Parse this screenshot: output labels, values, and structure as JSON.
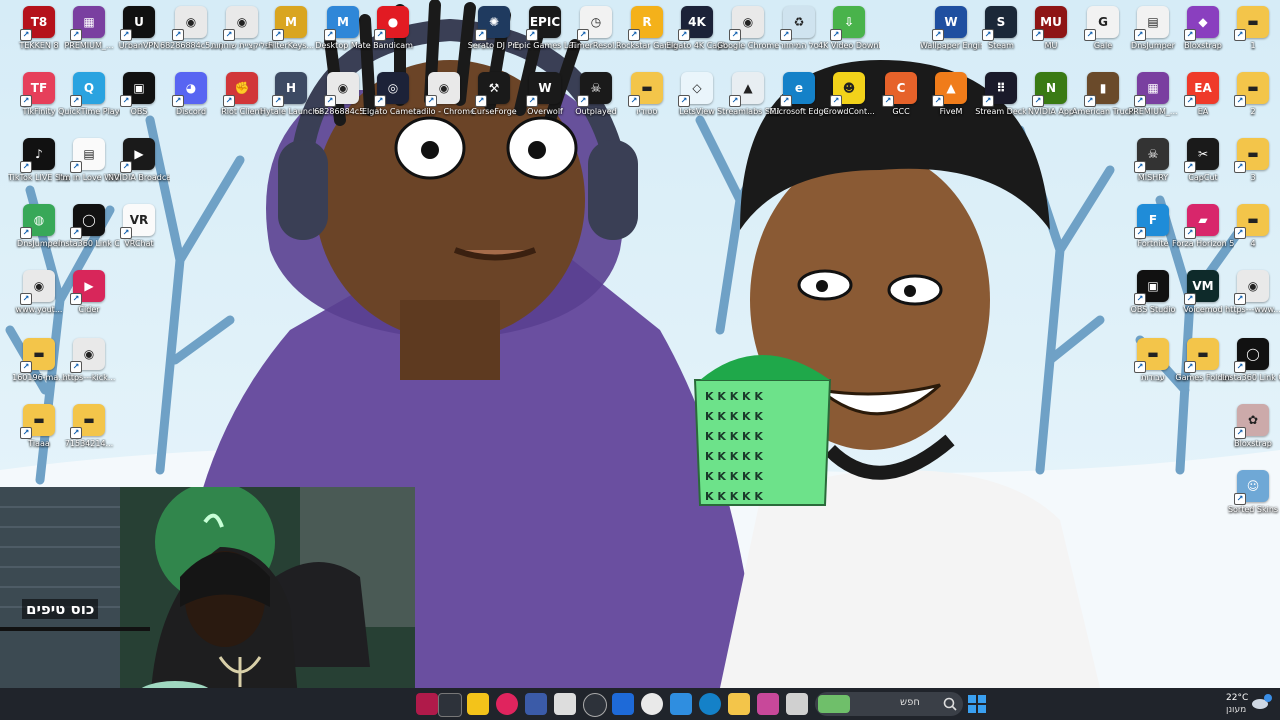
{
  "desktop": {
    "icons": [
      {
        "label": "TEKKEN 8",
        "name": "tekken8",
        "color": "#b5121b",
        "glyph": "T8"
      },
      {
        "label": "PREMIUM_...",
        "name": "premium-1",
        "color": "#7a3fa0",
        "glyph": "▦"
      },
      {
        "label": "UrbanVPN",
        "name": "urbanvpn",
        "color": "#101010",
        "glyph": "U"
      },
      {
        "label": "68286884c5... עותק",
        "name": "chrome-file-1",
        "color": "#e9e9e9",
        "glyph": "◉"
      },
      {
        "label": "אפליקציית שוחחות",
        "name": "chrome-app-1",
        "color": "#e9e9e9",
        "glyph": "◉"
      },
      {
        "label": "FilterKeys...",
        "name": "filterkeys",
        "color": "#d9a520",
        "glyph": "M"
      },
      {
        "label": "Desktop Mate",
        "name": "desktop-mate",
        "color": "#2f87d8",
        "glyph": "M"
      },
      {
        "label": "Bandicam",
        "name": "bandicam",
        "color": "#e21b23",
        "glyph": "●"
      },
      {
        "label": "Serato DJ Pro",
        "name": "serato",
        "color": "#1f3a5f",
        "glyph": "✺"
      },
      {
        "label": "Epic Games Launcher",
        "name": "epic-games",
        "color": "#1a1a1a",
        "glyph": "EPIC"
      },
      {
        "label": "TimerResol...",
        "name": "timerres",
        "color": "#f2f2f2",
        "glyph": "◷"
      },
      {
        "label": "Rockstar Games...",
        "name": "rockstar",
        "color": "#f4b11a",
        "glyph": "R"
      },
      {
        "label": "Elgato 4K Captur...",
        "name": "elgato-4k",
        "color": "#1c2238",
        "glyph": "4K"
      },
      {
        "label": "Google Chrome",
        "name": "google-chrome",
        "color": "#e9e9e9",
        "glyph": "◉"
      },
      {
        "label": "סל המיחזור",
        "name": "recycle-bin",
        "color": "#cfe3ef",
        "glyph": "♻"
      },
      {
        "label": "4K Video Downloader+",
        "name": "4k-video",
        "color": "#49b34b",
        "glyph": "⇩"
      },
      {
        "label": "Wallpaper Engine",
        "name": "wallpaper-engine",
        "color": "#1f4fa0",
        "glyph": "W"
      },
      {
        "label": "Steam",
        "name": "steam",
        "color": "#1b2838",
        "glyph": "S"
      },
      {
        "label": "MU",
        "name": "mu",
        "color": "#8e1515",
        "glyph": "MU"
      },
      {
        "label": "Gale",
        "name": "gale",
        "color": "#f2f2f2",
        "glyph": "G"
      },
      {
        "label": "DnsJumper",
        "name": "dnsjumper-file",
        "color": "#f2f2f2",
        "glyph": "▤"
      },
      {
        "label": "Bloxstrap",
        "name": "bloxstrap",
        "color": "#8a3fbf",
        "glyph": "◆"
      },
      {
        "label": "1",
        "name": "folder-1",
        "color": "#f3c54a",
        "glyph": "▬"
      },
      {
        "label": "TikFinity",
        "name": "tikfinity",
        "color": "#e63f5a",
        "glyph": "TF"
      },
      {
        "label": "QuickTime Player",
        "name": "quicktime",
        "color": "#2aa3e0",
        "glyph": "Q"
      },
      {
        "label": "OBS",
        "name": "obs-file",
        "color": "#111",
        "glyph": "▣"
      },
      {
        "label": "Discord",
        "name": "discord",
        "color": "#5865f2",
        "glyph": "◕"
      },
      {
        "label": "Riot Client",
        "name": "riot",
        "color": "#d13639",
        "glyph": "✊"
      },
      {
        "label": "Hytale Launcher",
        "name": "hytale",
        "color": "#3d4a63",
        "glyph": "H"
      },
      {
        "label": "68286884c5...",
        "name": "chrome-file-2",
        "color": "#e9e9e9",
        "glyph": "◉"
      },
      {
        "label": "Elgato Camera Hub",
        "name": "elgato-cam",
        "color": "#1c2238",
        "glyph": "◎"
      },
      {
        "label": "tadilo - Chrome",
        "name": "tadilo",
        "color": "#e9e9e9",
        "glyph": "◉"
      },
      {
        "label": "CurseForge",
        "name": "curseforge",
        "color": "#1a1a1a",
        "glyph": "⚒"
      },
      {
        "label": "Overwolf",
        "name": "overwolf",
        "color": "#1a1a1a",
        "glyph": "W"
      },
      {
        "label": "Outplayed",
        "name": "outplayed",
        "color": "#1a1a1a",
        "glyph": "☠"
      },
      {
        "label": "סטודיו",
        "name": "folder-studio",
        "color": "#f3c54a",
        "glyph": "▬"
      },
      {
        "label": "LetsView",
        "name": "letsview",
        "color": "#eaf5fb",
        "glyph": "◇"
      },
      {
        "label": "Streamlabs SE.Live",
        "name": "streamlabs",
        "color": "#e8eef2",
        "glyph": "▲"
      },
      {
        "label": "Microsoft Edge",
        "name": "edge",
        "color": "#1481c8",
        "glyph": "e"
      },
      {
        "label": "CrowdCont...",
        "name": "crowdcontrol",
        "color": "#f2d21a",
        "glyph": "☻"
      },
      {
        "label": "GCC",
        "name": "gcc",
        "color": "#e6622a",
        "glyph": "C"
      },
      {
        "label": "FiveM",
        "name": "fivem",
        "color": "#f07c1a",
        "glyph": "▲"
      },
      {
        "label": "Stream Deck",
        "name": "stream-deck",
        "color": "#1a1a2a",
        "glyph": "⠿"
      },
      {
        "label": "NVIDIA App",
        "name": "nvidia-app",
        "color": "#3a7a14",
        "glyph": "N"
      },
      {
        "label": "American Truck Si...",
        "name": "ats",
        "color": "#6a4a2a",
        "glyph": "▮"
      },
      {
        "label": "PREMIUM_...",
        "name": "premium-2",
        "color": "#7a3fa0",
        "glyph": "▦"
      },
      {
        "label": "EA",
        "name": "ea",
        "color": "#ef3a2a",
        "glyph": "EA"
      },
      {
        "label": "2",
        "name": "folder-2",
        "color": "#f3c54a",
        "glyph": "▬"
      },
      {
        "label": "TikTok LIVE Studio",
        "name": "tiktok-live",
        "color": "#111",
        "glyph": "♪"
      },
      {
        "label": "I'm in Love With Your ...",
        "name": "txt-file",
        "color": "#fafafa",
        "glyph": "▤"
      },
      {
        "label": "NVIDIA Broadcast",
        "name": "nvidia-broadcast",
        "color": "#1a1a1a",
        "glyph": "▶"
      },
      {
        "label": "MISHRY",
        "name": "mishry",
        "color": "#333",
        "glyph": "☠"
      },
      {
        "label": "CapCut",
        "name": "capcut",
        "color": "#1a1a1a",
        "glyph": "✂"
      },
      {
        "label": "3",
        "name": "folder-3",
        "color": "#f3c54a",
        "glyph": "▬"
      },
      {
        "label": "DnsJumper",
        "name": "dnsjumper",
        "color": "#38a858",
        "glyph": "◍"
      },
      {
        "label": "Insta360 Link Controller",
        "name": "insta360",
        "color": "#111",
        "glyph": "◯"
      },
      {
        "label": "VRChat",
        "name": "vrchat",
        "color": "#fafafa",
        "glyph": "VR"
      },
      {
        "label": "Fortnite",
        "name": "fortnite",
        "color": "#1f8cd8",
        "glyph": "F"
      },
      {
        "label": "Forza Horizon 5",
        "name": "forza",
        "color": "#d8266b",
        "glyph": "▰"
      },
      {
        "label": "4",
        "name": "folder-4",
        "color": "#f3c54a",
        "glyph": "▬"
      },
      {
        "label": "www.yout...",
        "name": "youtube-link",
        "color": "#e9e9e9",
        "glyph": "◉"
      },
      {
        "label": "Cider",
        "name": "cider",
        "color": "#d8265a",
        "glyph": "▶"
      },
      {
        "label": "OBS Studio",
        "name": "obs-studio",
        "color": "#111",
        "glyph": "▣"
      },
      {
        "label": "Voicemod",
        "name": "voicemod",
        "color": "#0e2a2a",
        "glyph": "VM"
      },
      {
        "label": "https---www...",
        "name": "chrome-link",
        "color": "#e9e9e9",
        "glyph": "◉"
      },
      {
        "label": "160196-ma...",
        "name": "folder-160196",
        "color": "#f3c54a",
        "glyph": "▬"
      },
      {
        "label": "https---kick...",
        "name": "kick-link",
        "color": "#e9e9e9",
        "glyph": "◉"
      },
      {
        "label": "עבודות",
        "name": "folder-work",
        "color": "#f3c54a",
        "glyph": "▬"
      },
      {
        "label": "Games Folder",
        "name": "folder-games",
        "color": "#f3c54a",
        "glyph": "▬"
      },
      {
        "label": "Insta360 Link Controller",
        "name": "insta360-2",
        "color": "#111",
        "glyph": "◯"
      },
      {
        "label": "Tiaaa",
        "name": "folder-tiaaa",
        "color": "#f3c54a",
        "glyph": "▬"
      },
      {
        "label": "71534214...",
        "name": "folder-7153",
        "color": "#f3c54a",
        "glyph": "▬"
      },
      {
        "label": "Bloxstrap",
        "name": "bloxstrap-img",
        "color": "#caa",
        "glyph": "✿"
      },
      {
        "label": "Sorted Skins",
        "name": "sorted-skins",
        "color": "#6fa8d6",
        "glyph": "☺"
      }
    ]
  },
  "webcam": {
    "caption": "כוס טיפים"
  },
  "taskbar": {
    "search_placeholder": "חפש",
    "weather_temp": "22°C",
    "weather_desc": "מעונן"
  }
}
